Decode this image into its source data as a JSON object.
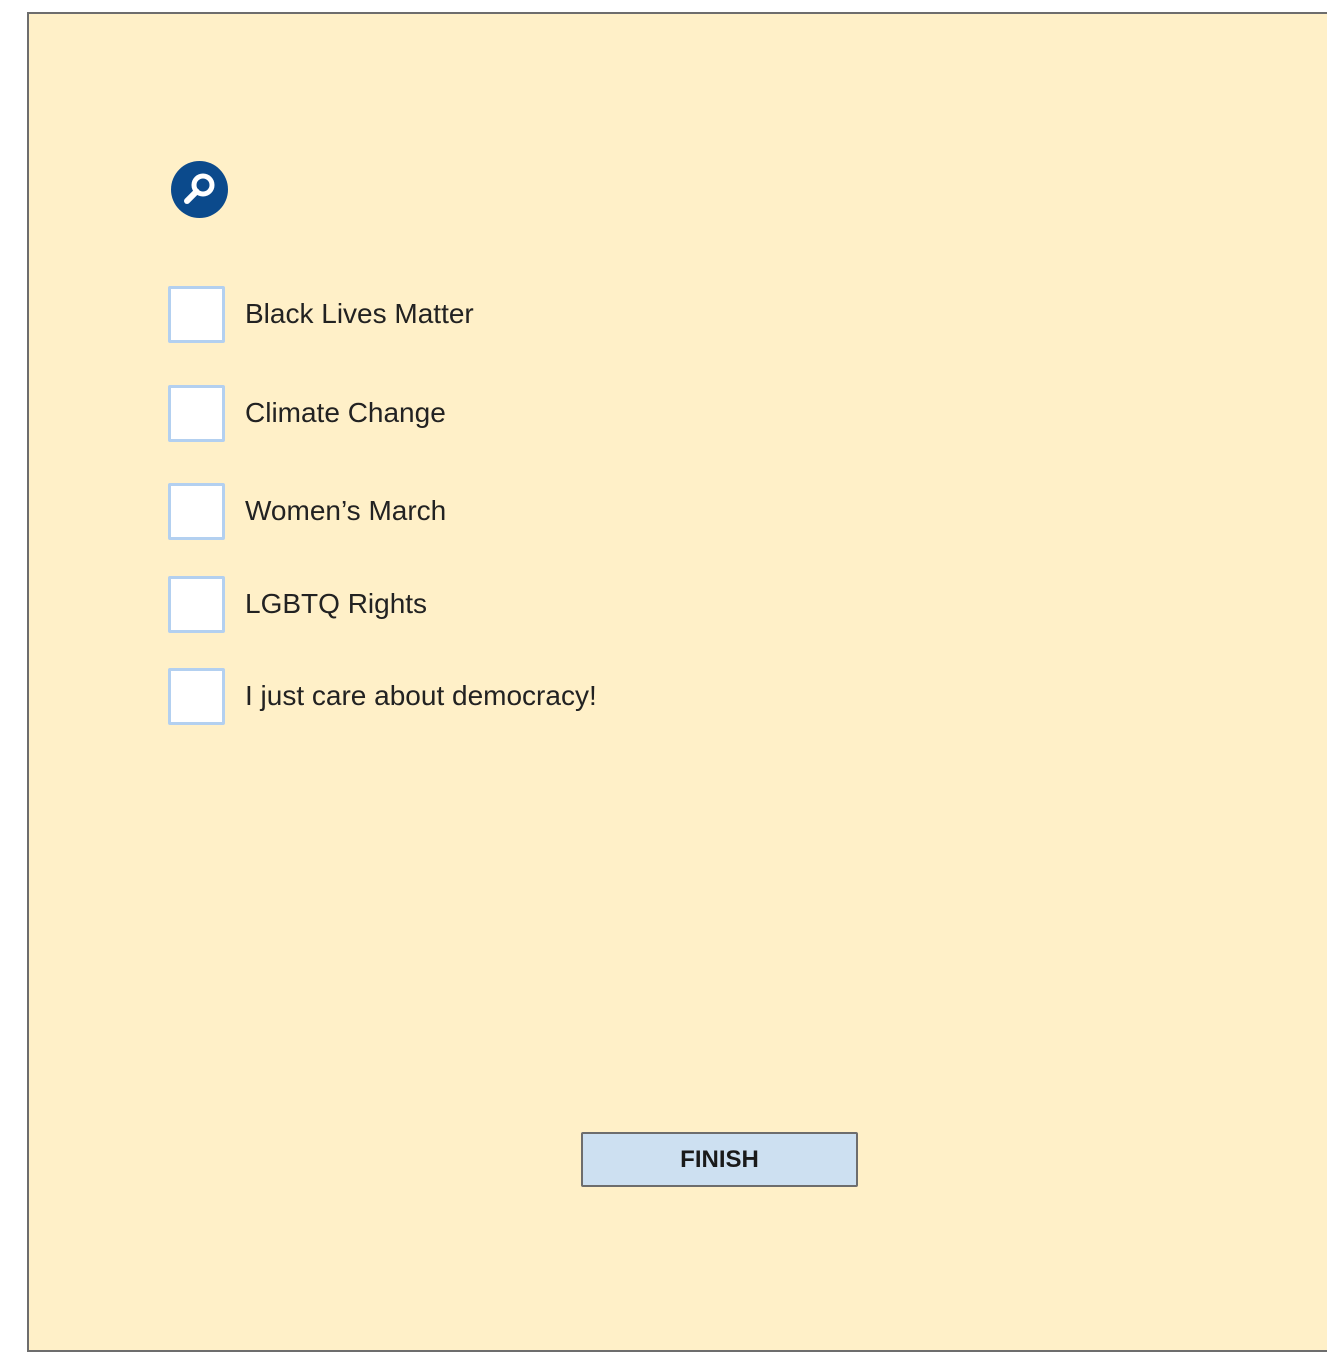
{
  "header": {
    "icon": "search-icon",
    "icon_color": "#0b4a8c"
  },
  "options": [
    {
      "label": "Black Lives Matter",
      "checked": false
    },
    {
      "label": "Climate Change",
      "checked": false
    },
    {
      "label": "Women’s March",
      "checked": false
    },
    {
      "label": "LGBTQ Rights",
      "checked": false
    },
    {
      "label": "I just care about democracy!",
      "checked": false
    }
  ],
  "footer": {
    "finish_label": "FINISH"
  },
  "colors": {
    "background": "#fff0c8",
    "checkbox_border": "#b3d0f0",
    "button_fill": "#cde0f1"
  }
}
